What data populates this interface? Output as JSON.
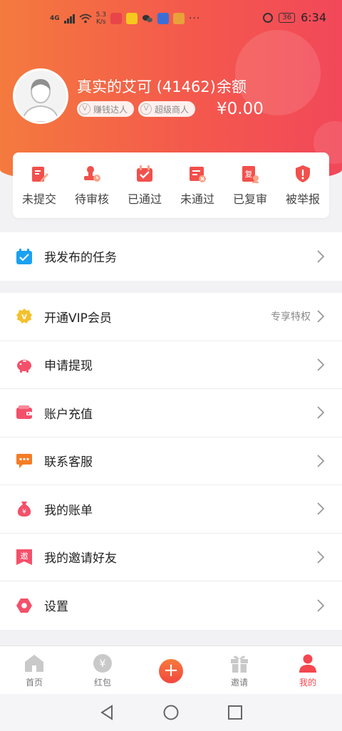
{
  "status_bar": {
    "network": "4G",
    "speed_value": "5.3",
    "speed_unit": "K/s",
    "battery": "36",
    "time": "6:34"
  },
  "profile": {
    "name": "真实的艾可 (41462)",
    "badges": [
      {
        "label": "赚钱达人"
      },
      {
        "label": "超级商人"
      }
    ],
    "balance_label": "余额",
    "balance_value": "¥0.00"
  },
  "task_status": [
    {
      "label": "未提交",
      "icon": "edit-doc-icon"
    },
    {
      "label": "待审核",
      "icon": "review-stamp-icon"
    },
    {
      "label": "已通过",
      "icon": "calendar-check-icon"
    },
    {
      "label": "未通过",
      "icon": "rejected-doc-icon"
    },
    {
      "label": "已复审",
      "icon": "re-review-icon"
    },
    {
      "label": "被举报",
      "icon": "warning-shield-icon"
    }
  ],
  "menu_group_1": [
    {
      "label": "我发布的任务",
      "icon": "calendar-check-icon"
    }
  ],
  "menu_group_2": [
    {
      "label": "开通VIP会员",
      "extra": "专享特权",
      "icon": "vip-badge-icon"
    },
    {
      "label": "申请提现",
      "icon": "piggy-bank-icon"
    },
    {
      "label": "账户充值",
      "icon": "wallet-icon"
    },
    {
      "label": "联系客服",
      "icon": "chat-bubble-icon"
    },
    {
      "label": "我的账单",
      "icon": "money-bag-icon"
    },
    {
      "label": "我的邀请好友",
      "icon": "invite-icon"
    },
    {
      "label": "设置",
      "icon": "settings-hexagon-icon"
    }
  ],
  "tabbar": {
    "items": [
      {
        "label": "首页",
        "icon": "home-icon"
      },
      {
        "label": "红包",
        "icon": "yuan-coin-icon"
      },
      {
        "label": "",
        "icon": "plus-icon"
      },
      {
        "label": "邀请",
        "icon": "gift-icon"
      },
      {
        "label": "我的",
        "icon": "user-icon"
      }
    ],
    "active": "我的"
  },
  "colors": {
    "accent": "#f4474f",
    "gradient_start": "#f47a3e",
    "gradient_end": "#f2485a"
  }
}
